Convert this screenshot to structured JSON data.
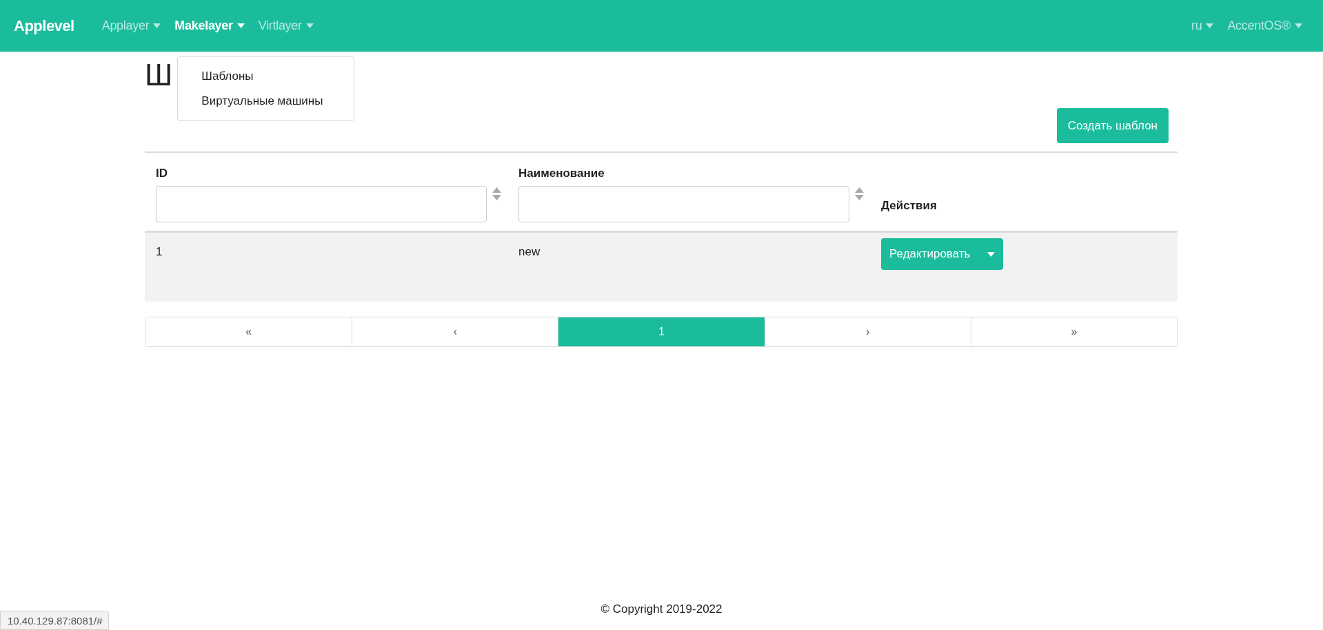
{
  "navbar": {
    "brand": "Applevel",
    "menus": [
      {
        "label": "Applayer",
        "open": false
      },
      {
        "label": "Makelayer",
        "open": true,
        "items": [
          "Шаблоны",
          "Виртуальные машины"
        ]
      },
      {
        "label": "Virtlayer",
        "open": false
      }
    ],
    "right_menus": [
      {
        "label": "ru"
      },
      {
        "label": "AccentOS®"
      }
    ]
  },
  "page_title": "Ш",
  "create_button": "Создать шаблон",
  "table": {
    "columns": [
      {
        "label": "ID",
        "kind": "filter"
      },
      {
        "label": "Наименование",
        "kind": "filter"
      },
      {
        "label": "Действия",
        "kind": "plain"
      }
    ],
    "rows": [
      {
        "id": "1",
        "name": "new",
        "action": "Редактировать"
      }
    ]
  },
  "pagination": [
    {
      "label": "«",
      "selected": false
    },
    {
      "label": "‹",
      "selected": false
    },
    {
      "label": "1",
      "selected": true
    },
    {
      "label": "›",
      "selected": false
    },
    {
      "label": "»",
      "selected": false
    }
  ],
  "footer": "© Copyright 2019-2022",
  "status_url": "10.40.129.87:8081/#"
}
